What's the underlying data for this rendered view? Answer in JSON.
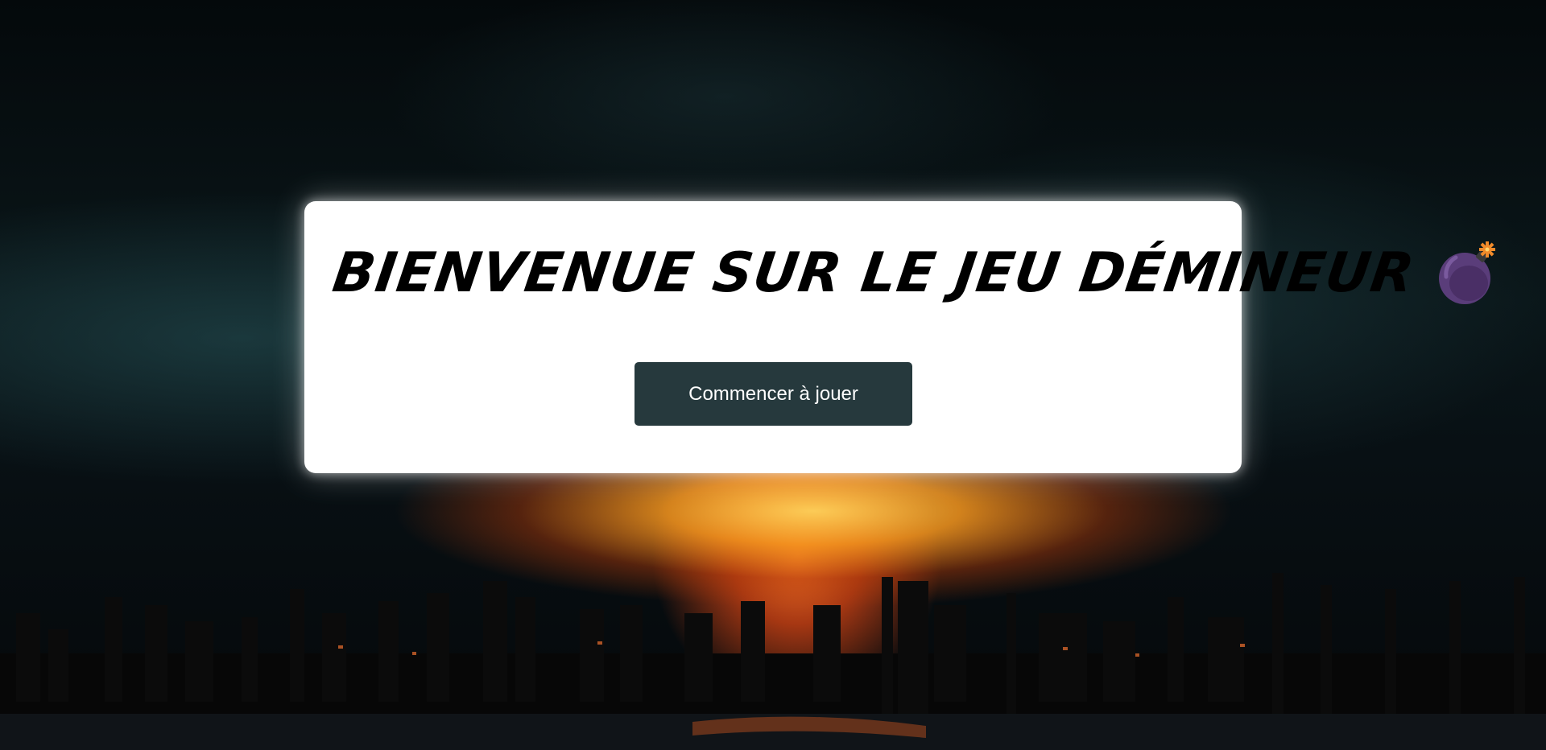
{
  "page": {
    "title": "Bienvenue sur le jeu Démineur",
    "bomb_icon": "bomb-icon"
  },
  "actions": {
    "start_label": "Commencer à jouer"
  },
  "colors": {
    "card_background": "#ffffff",
    "button_background": "#26393d",
    "button_text": "#ffffff",
    "bomb_body": "#5a3d7a",
    "bomb_fuse": "#f08a2a"
  }
}
